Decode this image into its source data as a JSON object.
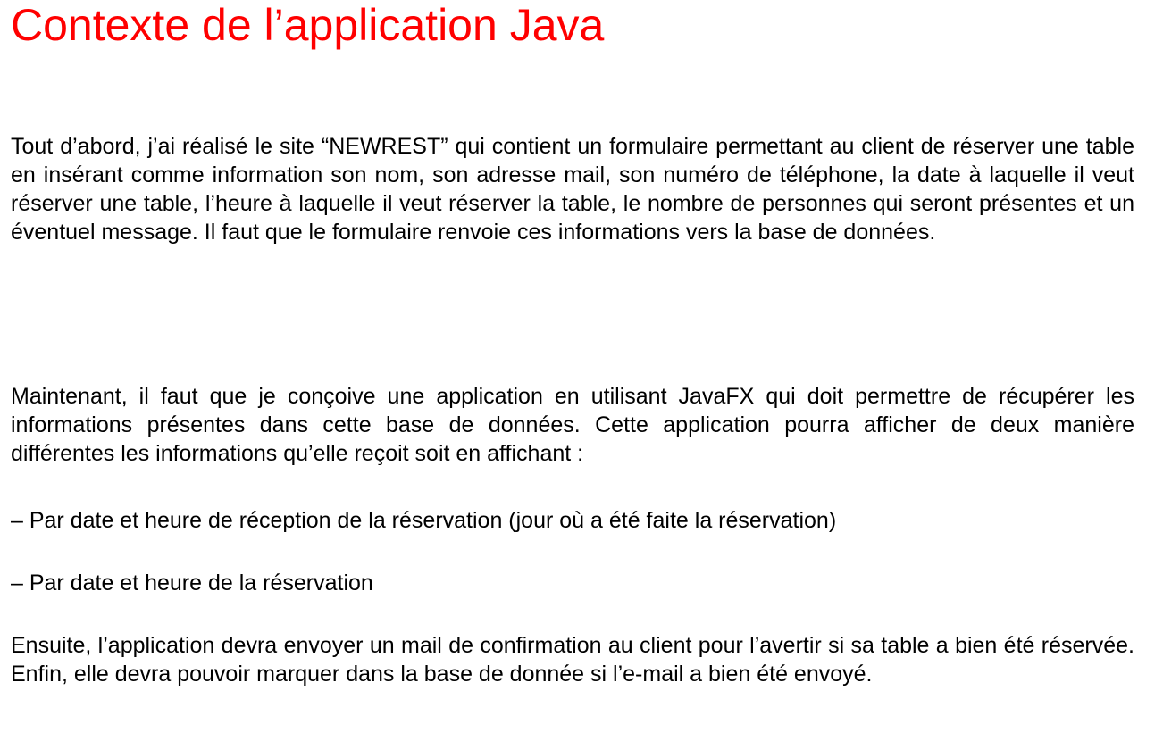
{
  "slide": {
    "title": "Contexte de l’application Java",
    "title_color": "#ff0000",
    "paragraphs": [
      "Tout d’abord, j’ai réalisé le site  “NEWREST” qui contient un formulaire permettant au client de réserver une table en insérant comme information son nom, son adresse mail, son numéro de téléphone, la date à laquelle il veut réserver une table, l’heure à laquelle il veut réserver la table, le nombre de personnes qui seront présentes et un éventuel message. Il faut que le formulaire renvoie ces informations vers la base de données.",
      "Maintenant, il faut que je conçoive une application en utilisant JavaFX qui doit permettre de récupérer les informations présentes dans cette base de données. Cette application pourra afficher de deux manière différentes les informations qu’elle reçoit soit en affichant :"
    ],
    "list_items": [
      "– Par date et heure de réception de la réservation (jour où a été faite la réservation)",
      "– Par date et heure de la réservation"
    ],
    "closing_paragraph": "Ensuite, l’application devra envoyer un mail de confirmation au client pour l’avertir si sa table a bien été réservée. Enfin, elle devra pouvoir marquer dans la base de donnée si l’e-mail a bien été envoyé."
  }
}
